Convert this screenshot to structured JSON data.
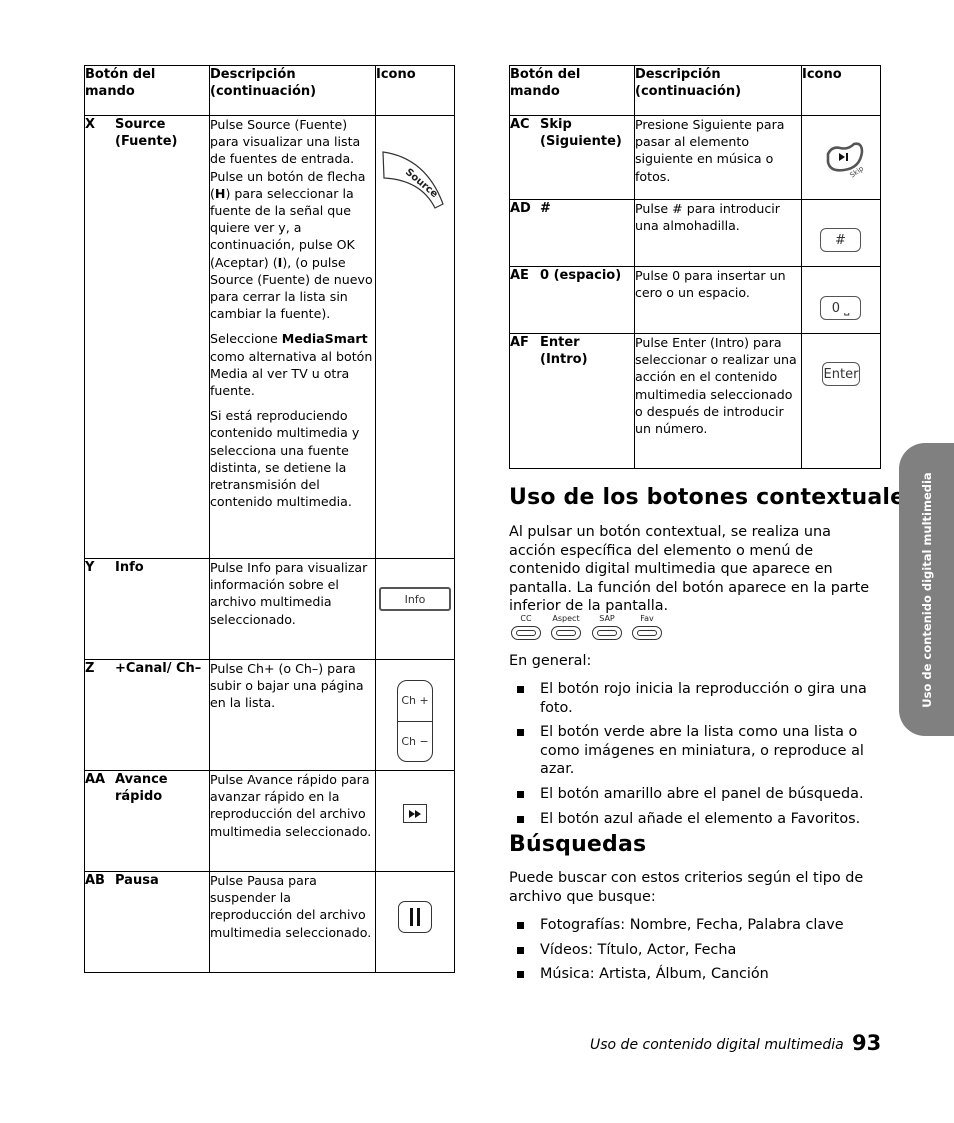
{
  "table_headers": {
    "button": "Botón del mando",
    "description": "Descripción (continuación)",
    "icon": "Icono"
  },
  "left_table": {
    "rows": [
      {
        "code": "X",
        "name": "Source (Fuente)",
        "paragraphs": [
          "Pulse Source (Fuente) para visualizar una lista de fuentes de entrada. Pulse un botón de flecha (H) para seleccionar la fuente de la señal que quiere ver y, a continuación, pulse OK (Aceptar) (I), (o pulse Source (Fuente) de nuevo para cerrar la lista sin cambiar la fuente).",
          "Seleccione MediaSmart como alternativa al botón Media al ver TV u otra fuente.",
          "Si está reproduciendo contenido multimedia y selecciona una fuente distinta, se detiene la retransmisión del contenido multimedia."
        ],
        "icon": "source-button-icon",
        "icon_label": "Source"
      },
      {
        "code": "Y",
        "name": "Info",
        "paragraphs": [
          "Pulse Info para visualizar información sobre el archivo multimedia seleccionado."
        ],
        "icon": "info-button-icon",
        "icon_label": "Info"
      },
      {
        "code": "Z",
        "name": "+Canal/ Ch–",
        "paragraphs": [
          "Pulse Ch+ (o Ch–) para subir o bajar una página en la lista."
        ],
        "icon": "channel-button-icon",
        "icon_label_up": "Ch +",
        "icon_label_down": "Ch −"
      },
      {
        "code": "AA",
        "name": "Avance rápido",
        "paragraphs": [
          "Pulse Avance rápido para avanzar rápido en la reproducción del archivo multimedia seleccionado."
        ],
        "icon": "fast-forward-icon",
        "icon_label": "▸▸"
      },
      {
        "code": "AB",
        "name": "Pausa",
        "paragraphs": [
          "Pulse Pausa para suspender la reproducción del archivo multimedia seleccionado."
        ],
        "icon": "pause-icon",
        "icon_label": "II"
      }
    ]
  },
  "right_table": {
    "rows": [
      {
        "code": "AC",
        "name": "Skip (Siguiente)",
        "paragraphs": [
          "Presione Siguiente para pasar al elemento siguiente en música o fotos."
        ],
        "icon": "skip-button-icon",
        "icon_label": "Skip"
      },
      {
        "code": "AD",
        "name": "#",
        "paragraphs": [
          "Pulse # para introducir una almohadilla."
        ],
        "icon": "hash-button-icon",
        "icon_label": "#"
      },
      {
        "code": "AE",
        "name": "0 (espacio)",
        "paragraphs": [
          "Pulse 0 para insertar un cero o un espacio."
        ],
        "icon": "zero-space-button-icon",
        "icon_label": "0 ⎵"
      },
      {
        "code": "AF",
        "name": "Enter (Intro)",
        "paragraphs": [
          "Pulse Enter (Intro) para seleccionar o realizar una acción en el contenido multimedia seleccionado o después de introducir un número."
        ],
        "icon": "enter-button-icon",
        "icon_label": "Enter"
      }
    ]
  },
  "contextual": {
    "heading": "Uso de los botones contextuales",
    "intro": "Al pulsar un botón contextual, se realiza una acción específica del elemento o menú de contenido digital multimedia que aparece en pantalla. La función del botón aparece en la parte inferior de la pantalla.",
    "buttons": [
      "CC",
      "Aspect",
      "SAP",
      "Fav"
    ],
    "general_label": "En general:",
    "bullets": [
      "El botón rojo inicia la reproducción o gira una foto.",
      "El botón verde abre la lista como una lista o como imágenes en miniatura, o reproduce al azar.",
      "El botón amarillo abre el panel de búsqueda.",
      "El botón azul añade el elemento a Favoritos."
    ]
  },
  "search": {
    "heading": "Búsquedas",
    "intro": "Puede buscar con estos criterios según el tipo de archivo que busque:",
    "bullets": [
      "Fotografías: Nombre, Fecha, Palabra clave",
      "Vídeos: Título, Actor, Fecha",
      "Música: Artista, Álbum, Canción"
    ]
  },
  "side_tab": "Uso de contenido digital multimedia",
  "footer": {
    "section": "Uso de contenido digital multimedia",
    "page_number": "93"
  },
  "colors": {
    "side_tab_bg": "#808080",
    "text": "#000000"
  }
}
